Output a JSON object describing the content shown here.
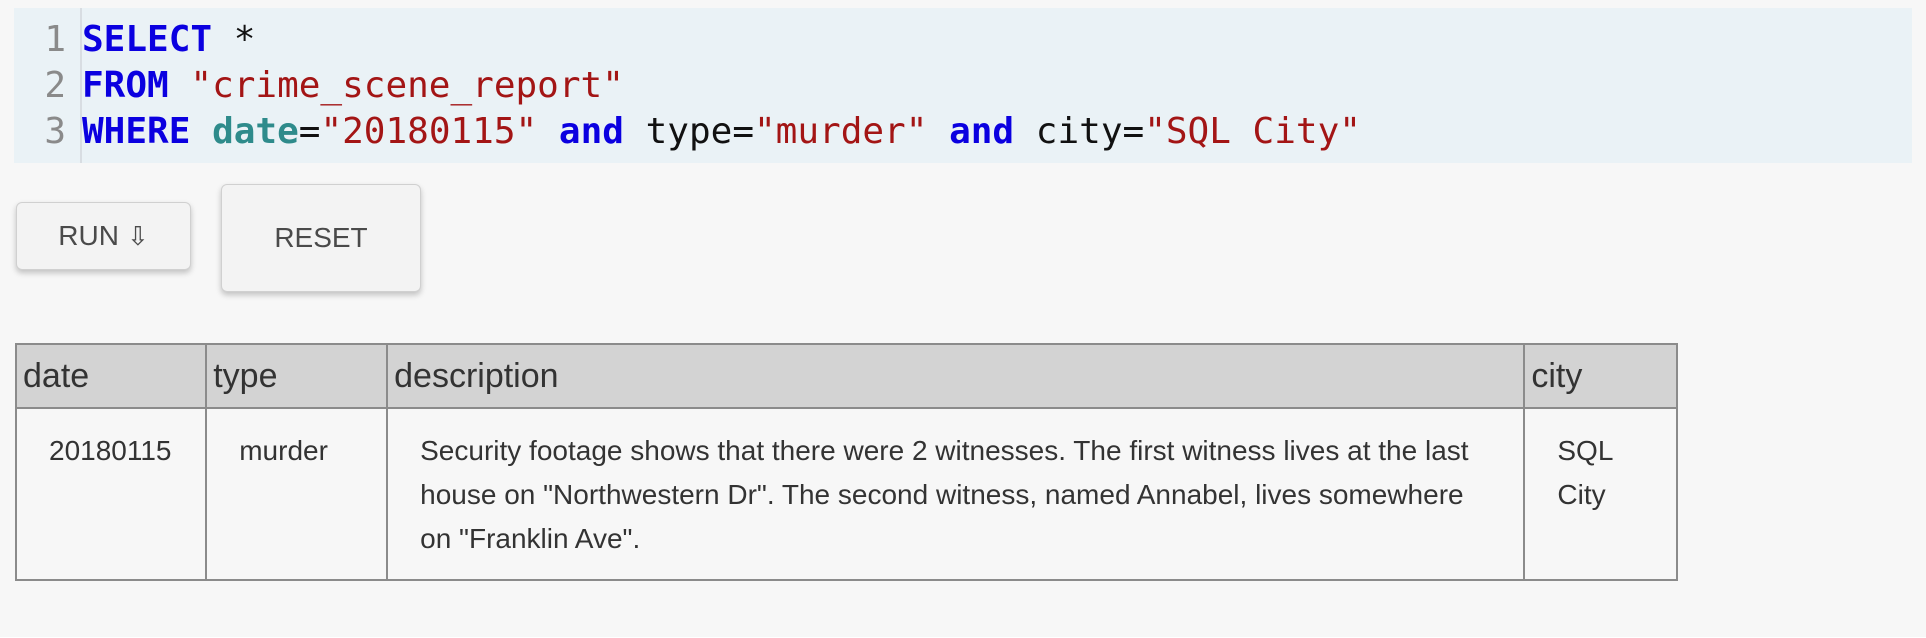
{
  "editor": {
    "line_numbers": [
      "1",
      "2",
      "3"
    ],
    "lines": [
      {
        "kw": "SELECT",
        "rest": " *"
      },
      {
        "kw": "FROM",
        "table": "\"crime_scene_report\""
      },
      {
        "kw": "WHERE",
        "col1": "date",
        "eq1": "=",
        "val1": "\"20180115\"",
        "and1": "and",
        "col2": "type",
        "eq2": "=",
        "val2": "\"murder\"",
        "and2": "and",
        "col3": "city",
        "eq3": "=",
        "val3": "\"SQL City\""
      }
    ]
  },
  "buttons": {
    "run_label": "RUN",
    "run_icon": "⇩",
    "reset_label": "RESET"
  },
  "results": {
    "columns": [
      "date",
      "type",
      "description",
      "city"
    ],
    "rows": [
      {
        "date": "20180115",
        "type": "murder",
        "description": "Security footage shows that there were 2 witnesses. The first witness lives at the last house on \"Northwestern Dr\". The second witness, named Annabel, lives somewhere on \"Franklin Ave\".",
        "city": "SQL City"
      }
    ]
  }
}
